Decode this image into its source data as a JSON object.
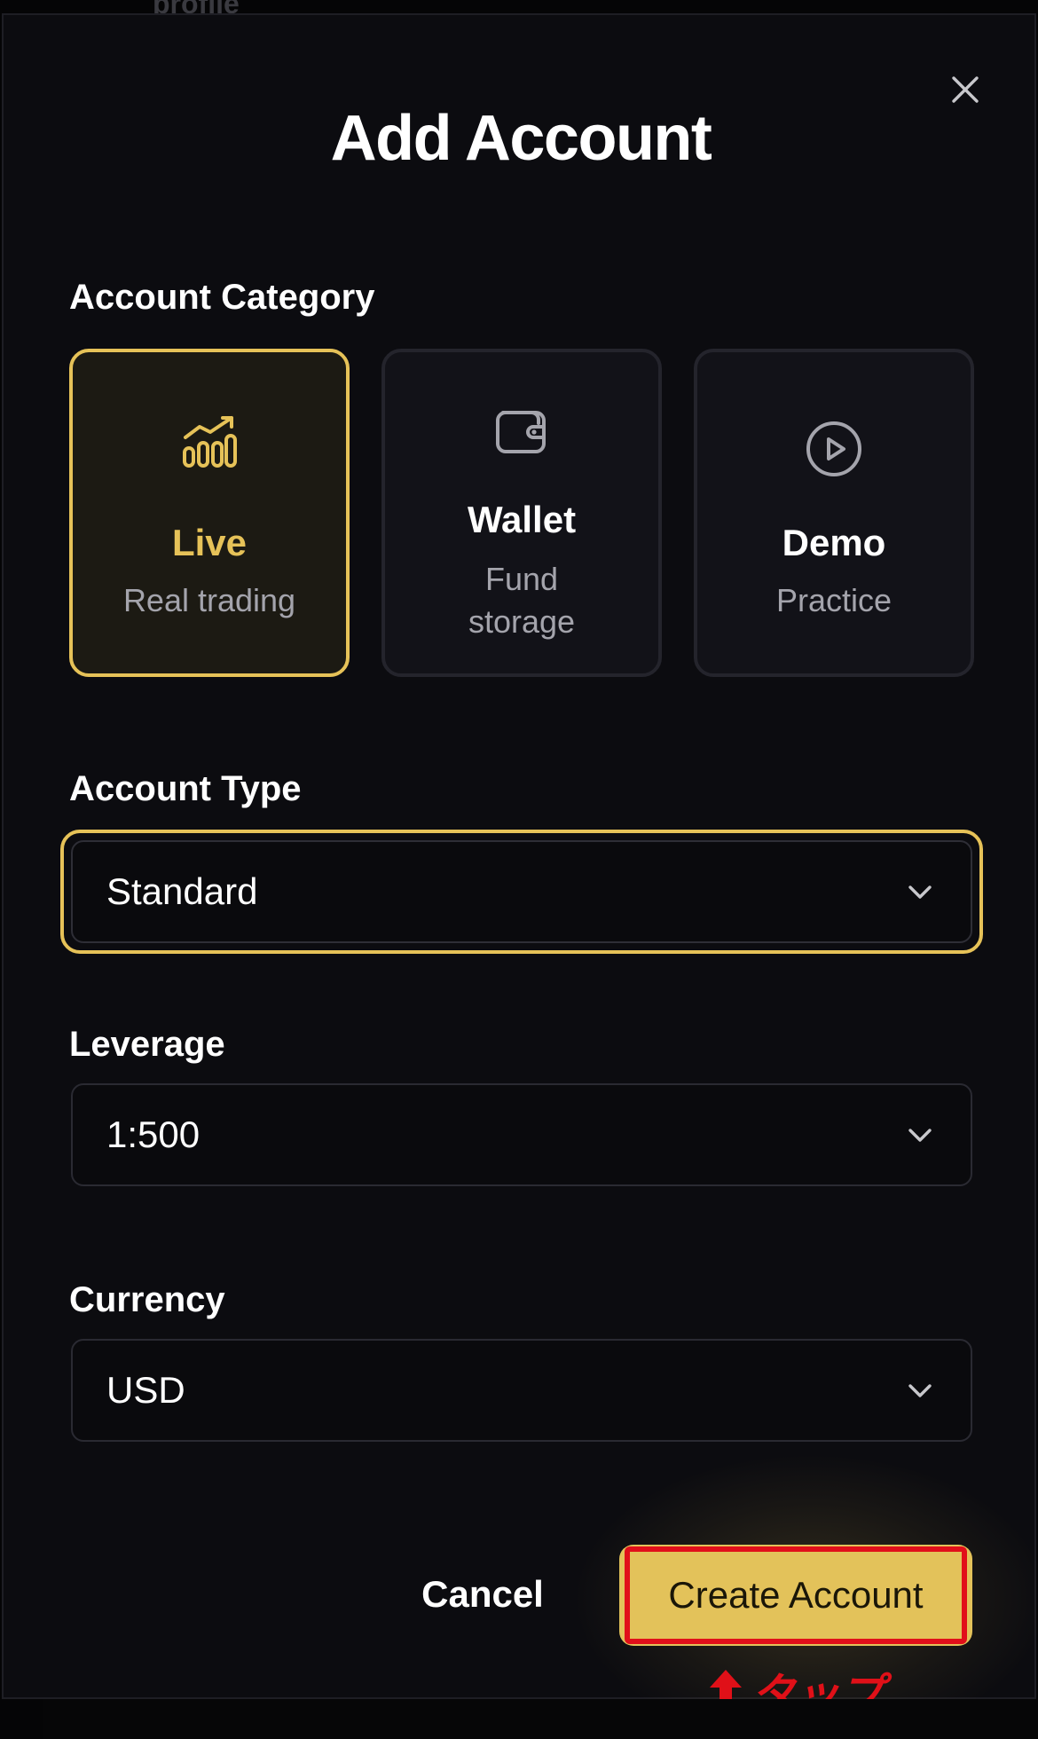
{
  "background_text": "profile",
  "modal": {
    "title": "Add Account",
    "close_icon": "close-icon"
  },
  "account_category": {
    "label": "Account Category",
    "options": [
      {
        "name": "Live",
        "description": "Real trading",
        "icon": "chart-growth-icon",
        "selected": true
      },
      {
        "name": "Wallet",
        "description_line1": "Fund",
        "description_line2": "storage",
        "icon": "wallet-icon",
        "selected": false
      },
      {
        "name": "Demo",
        "description": "Practice",
        "icon": "play-circle-icon",
        "selected": false
      }
    ]
  },
  "account_type": {
    "label": "Account Type",
    "value": "Standard"
  },
  "leverage": {
    "label": "Leverage",
    "value": "1:500"
  },
  "currency": {
    "label": "Currency",
    "value": "USD"
  },
  "actions": {
    "cancel_label": "Cancel",
    "create_label": "Create Account"
  },
  "annotation": {
    "text": "タップ",
    "color": "#e01018"
  },
  "colors": {
    "accent": "#e6c258",
    "background": "#0c0c10",
    "button_fill": "#e3c25a",
    "annotation_red": "#e10f1a"
  }
}
